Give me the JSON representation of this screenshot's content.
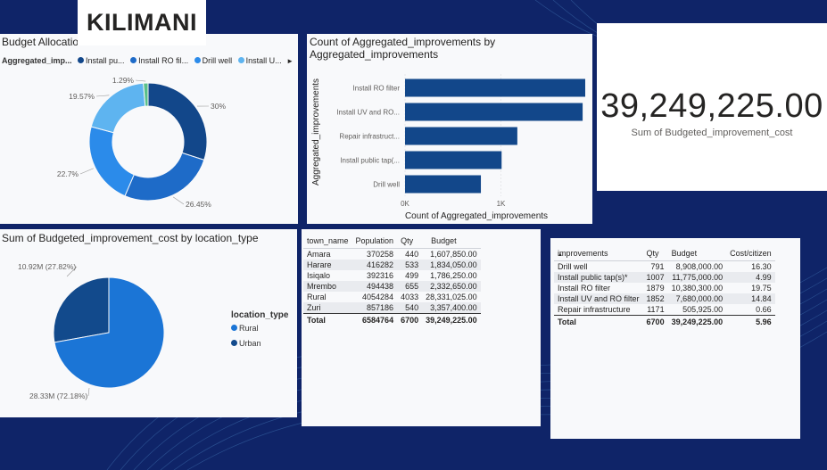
{
  "header": {
    "logo_text": "KILIMANI"
  },
  "colors": {
    "background": "#0f2468",
    "dark_blue": "#12478a",
    "mid_blue": "#1e6bc8",
    "blue": "#2b8bea",
    "light_blue": "#5eb4f0",
    "green": "#59c08a",
    "bar": "#12478a",
    "rural": "#1b75d6",
    "urban": "#124a8c"
  },
  "budget_allocation": {
    "title": "Budget Allocatio",
    "legend_label": "Aggregated_imp...",
    "legend_items": [
      "Install pu...",
      "Install RO fil...",
      "Drill well",
      "Install U..."
    ],
    "legend_arrow": "►",
    "slice_labels": [
      "30%",
      "26.45%",
      "22.7%",
      "19.57%",
      "1.29%"
    ],
    "chart_data": {
      "type": "pie",
      "variant": "donut",
      "slices": [
        {
          "label": "30%",
          "value": 30.0,
          "color": "#12478a"
        },
        {
          "label": "26.45%",
          "value": 26.45,
          "color": "#1e6bc8"
        },
        {
          "label": "22.7%",
          "value": 22.7,
          "color": "#2b8bea"
        },
        {
          "label": "19.57%",
          "value": 19.57,
          "color": "#5eb4f0"
        },
        {
          "label": "1.29%",
          "value": 1.29,
          "color": "#59c08a"
        }
      ]
    }
  },
  "count_chart": {
    "title_line1": "Count of Aggregated_improvements by",
    "title_line2": "Aggregated_improvements",
    "y_axis_label": "Aggregated_improvements",
    "x_axis_label": "Count of Aggregated_improvements",
    "chart_data": {
      "type": "bar",
      "orientation": "horizontal",
      "categories": [
        "Install RO filter",
        "Install UV and RO...",
        "Repair infrastruct...",
        "Install public tap(...",
        "Drill well"
      ],
      "values": [
        1879,
        1852,
        1171,
        1007,
        791
      ],
      "xlim": [
        0,
        2000
      ],
      "ticks": [
        {
          "value": 0,
          "label": "0K"
        },
        {
          "value": 1000,
          "label": "1K"
        },
        {
          "value": 2000,
          "label": "2K"
        }
      ],
      "xlabel": "Count of Aggregated_improvements",
      "ylabel": "Aggregated_improvements",
      "title": "Count of Aggregated_improvements by Aggregated_improvements"
    }
  },
  "kpi": {
    "value": "39,249,225.00",
    "label": "Sum of Budgeted_improvement_cost"
  },
  "location_chart": {
    "title": "Sum of Budgeted_improvement_cost by location_type",
    "legend_title": "location_type",
    "legend_items": [
      "Rural",
      "Urban"
    ],
    "label_urban": "10.92M (27.82%)",
    "label_rural": "28.33M (72.18%)",
    "chart_data": {
      "type": "pie",
      "title": "Sum of Budgeted_improvement_cost by location_type",
      "slices": [
        {
          "name": "Rural",
          "value": 28.33,
          "percent": 72.18,
          "label": "28.33M (72.18%)",
          "color": "#1b75d6"
        },
        {
          "name": "Urban",
          "value": 10.92,
          "percent": 27.82,
          "label": "10.92M (27.82%)",
          "color": "#124a8c"
        }
      ]
    }
  },
  "town_table": {
    "headers": [
      "town_name",
      "Population",
      "Qty",
      "Budget"
    ],
    "rows": [
      [
        "Amara",
        "370258",
        "440",
        "1,607,850.00"
      ],
      [
        "Harare",
        "416282",
        "533",
        "1,834,050.00"
      ],
      [
        "Isiqalo",
        "392316",
        "499",
        "1,786,250.00"
      ],
      [
        "Mrembo",
        "494438",
        "655",
        "2,332,650.00"
      ],
      [
        "Rural",
        "4054284",
        "4033",
        "28,331,025.00"
      ],
      [
        "Zuri",
        "857186",
        "540",
        "3,357,400.00"
      ]
    ],
    "total": [
      "Total",
      "6584764",
      "6700",
      "39,249,225.00"
    ]
  },
  "improvement_table": {
    "headers": [
      "improvements",
      "Qty",
      "Budget",
      "Cost/citizen"
    ],
    "sort_indicator": "▲",
    "rows": [
      [
        "Drill well",
        "791",
        "8,908,000.00",
        "16.30"
      ],
      [
        "Install public tap(s)*",
        "1007",
        "11,775,000.00",
        "4.99"
      ],
      [
        "Install RO filter",
        "1879",
        "10,380,300.00",
        "19.75"
      ],
      [
        "Install UV and RO filter",
        "1852",
        "7,680,000.00",
        "14.84"
      ],
      [
        "Repair infrastructure",
        "1171",
        "505,925.00",
        "0.66"
      ]
    ],
    "total": [
      "Total",
      "6700",
      "39,249,225.00",
      "5.96"
    ]
  }
}
